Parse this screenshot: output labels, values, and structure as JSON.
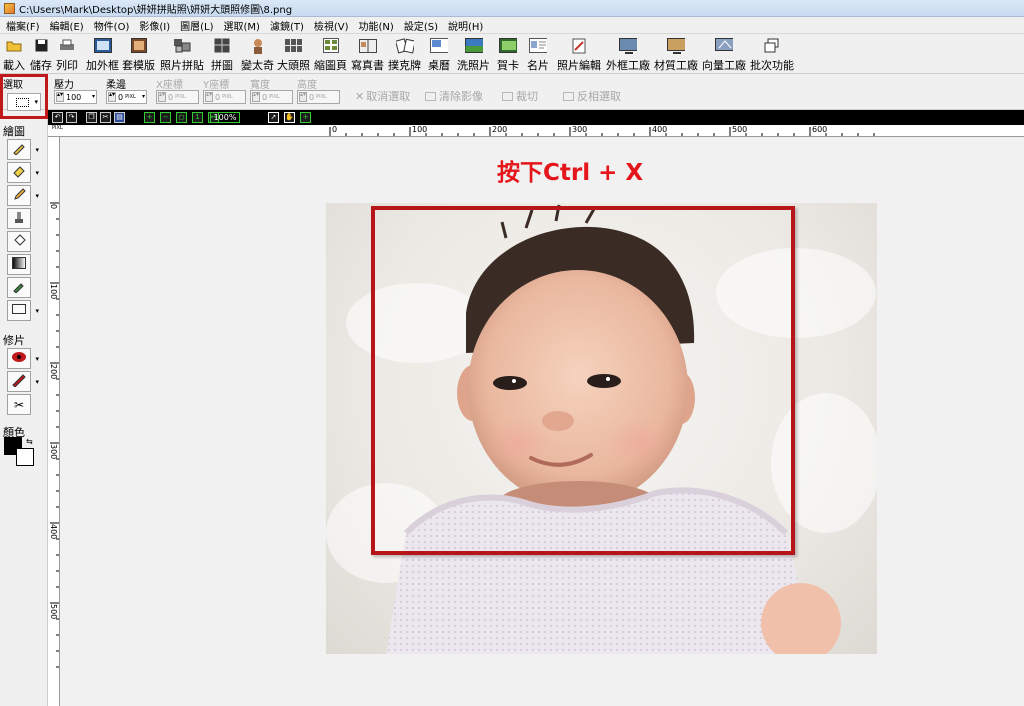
{
  "window": {
    "title": "C:\\Users\\Mark\\Desktop\\妍妍拼貼照\\妍妍大頭照修圖\\8.png"
  },
  "menu": [
    "檔案(F)",
    "編輯(E)",
    "物件(O)",
    "影像(I)",
    "圖層(L)",
    "選取(M)",
    "濾鏡(T)",
    "檢視(V)",
    "功能(N)",
    "設定(S)",
    "說明(H)"
  ],
  "toolbar": [
    {
      "label": "載入",
      "icon": "open-folder-icon"
    },
    {
      "label": "儲存",
      "icon": "save-disk-icon"
    },
    {
      "label": "列印",
      "icon": "printer-icon"
    },
    {
      "label": "加外框",
      "icon": "add-frame-icon"
    },
    {
      "label": "套模版",
      "icon": "template-icon"
    },
    {
      "label": "照片拼貼",
      "icon": "photo-collage-icon"
    },
    {
      "label": "拼圖",
      "icon": "puzzle-icon"
    },
    {
      "label": "變太奇",
      "icon": "montage-icon"
    },
    {
      "label": "大頭照",
      "icon": "id-photo-icon"
    },
    {
      "label": "縮圖頁",
      "icon": "thumbnail-page-icon"
    },
    {
      "label": "寫真書",
      "icon": "photo-book-icon"
    },
    {
      "label": "撲克牌",
      "icon": "poker-cards-icon"
    },
    {
      "label": "桌曆",
      "icon": "desk-calendar-icon"
    },
    {
      "label": "洗照片",
      "icon": "print-photo-icon"
    },
    {
      "label": "賀卡",
      "icon": "greeting-card-icon"
    },
    {
      "label": "名片",
      "icon": "business-card-icon"
    },
    {
      "label": "照片編輯",
      "icon": "photo-edit-icon"
    },
    {
      "label": "外框工廠",
      "icon": "frame-factory-icon"
    },
    {
      "label": "材質工廠",
      "icon": "texture-factory-icon"
    },
    {
      "label": "向量工廠",
      "icon": "vector-factory-icon"
    },
    {
      "label": "批次功能",
      "icon": "batch-icon"
    }
  ],
  "properties": {
    "select_label": "選取",
    "pressure_label": "壓力",
    "pressure_value": "100",
    "feather_label": "柔邊",
    "feather_value": "0",
    "x_label": "X座標",
    "x_value": "0",
    "y_label": "Y座標",
    "y_value": "0",
    "width_label": "寬度",
    "width_value": "0",
    "height_label": "高度",
    "height_value": "0",
    "unit": "PIXL",
    "cancel_select": "取消選取",
    "clear_image": "清除影像",
    "crop": "裁切",
    "invert_select": "反相選取"
  },
  "view": {
    "zoom": "100%"
  },
  "tools": {
    "draw_section": "繪圖",
    "retouch_section": "修片",
    "color_section": "顏色"
  },
  "ruler": {
    "unit": "PIXL",
    "top": [
      "0",
      "100",
      "200",
      "300",
      "400",
      "500",
      "600"
    ],
    "left": [
      "0",
      "100",
      "200",
      "300",
      "400",
      "500"
    ]
  },
  "canvas": {
    "instruction": "按下Ctrl + X"
  },
  "colors": {
    "accent_red": "#e5161b",
    "frame_red": "#b7151a"
  }
}
